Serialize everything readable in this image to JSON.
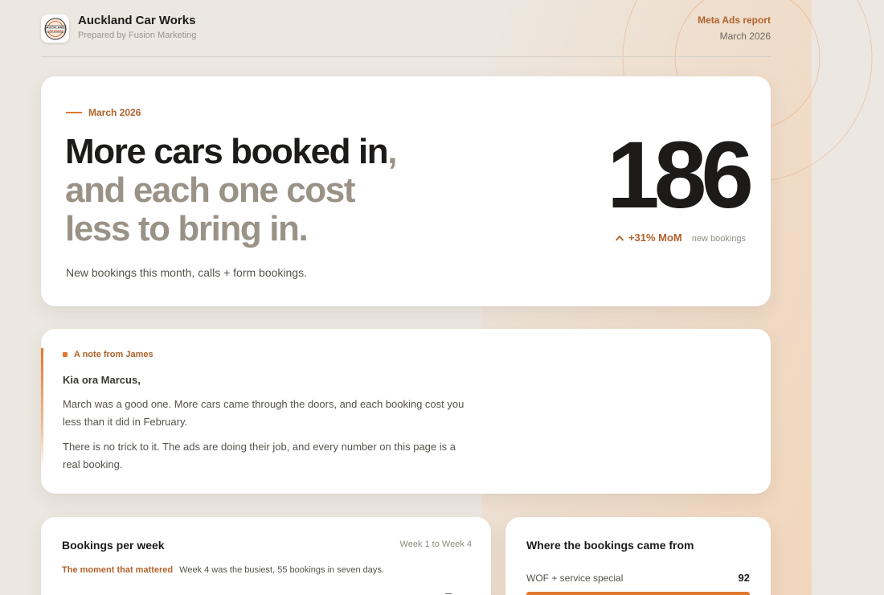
{
  "header": {
    "brand_name": "Auckland Car Works",
    "brand_sub": "Prepared by Fusion Marketing",
    "logo_top": "AUCKLAND",
    "logo_bottom": "CAR WORKS",
    "report_label": "Meta Ads report",
    "report_date": "March 2026"
  },
  "hero": {
    "eyebrow": "March 2026",
    "headline_strong": "More cars booked in",
    "headline_muted": ", and each one cost less to bring in.",
    "subtitle": "New bookings this month, calls + form bookings.",
    "big_number": "186",
    "mom_value": "+31% MoM",
    "mom_label": "new bookings"
  },
  "note": {
    "eyebrow": "A note from James",
    "greeting": "Kia ora Marcus,",
    "paragraph_1": "March was a good one. More cars came through the doors, and each booking cost you less than it did in February.",
    "paragraph_2": "There is no trick to it. The ads are doing their job, and every number on this page is a real booking."
  },
  "weekly": {
    "title": "Bookings per week",
    "range": "Week 1 to Week 4",
    "moment_label": "The moment that mattered",
    "moment_text": "Week 4 was the busiest, 55 bookings in seven days."
  },
  "sources": {
    "title": "Where the bookings came from",
    "items": [
      {
        "label": "WOF + service special",
        "value": "92",
        "share": 1.0
      }
    ]
  },
  "colors": {
    "accent": "#e0782f",
    "accent_text": "#b0622c",
    "muted_headline": "#9a9287",
    "background": "#ece8e1"
  }
}
